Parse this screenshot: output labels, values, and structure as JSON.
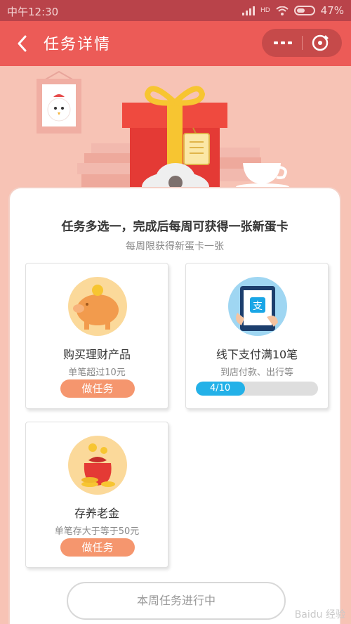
{
  "status_bar": {
    "time": "中午12:30",
    "battery": "47%",
    "network": "HD"
  },
  "nav": {
    "title": "任务详情"
  },
  "panel": {
    "title": "任务多选一，完成后每周可获得一张新蛋卡",
    "subtitle": "每周限获得新蛋卡一张"
  },
  "tasks": [
    {
      "name": "购买理财产品",
      "desc": "单笔超过10元",
      "button": "做任务"
    },
    {
      "name": "线下支付满10笔",
      "desc": "到店付款、出行等",
      "progress_text": "4/10",
      "progress": 0.4
    },
    {
      "name": "存养老金",
      "desc": "单笔存大于等于50元",
      "button": "做任务"
    }
  ],
  "footer": {
    "button": "本周任务进行中"
  },
  "watermark": "Baidu 经验",
  "colors": {
    "nav_bg": "#ec5b57",
    "status_bg": "#b9434a",
    "page_bg": "#f7c3b5",
    "task_button": "#f5966e",
    "progress_fill": "#23b1e8"
  },
  "icons": {
    "back": "chevron-left-icon",
    "more": "more-dots-icon",
    "close": "close-circle-icon",
    "piggy": "piggy-bank-icon",
    "alipay_tablet": "alipay-tablet-icon",
    "money_bag": "money-bag-icon"
  }
}
